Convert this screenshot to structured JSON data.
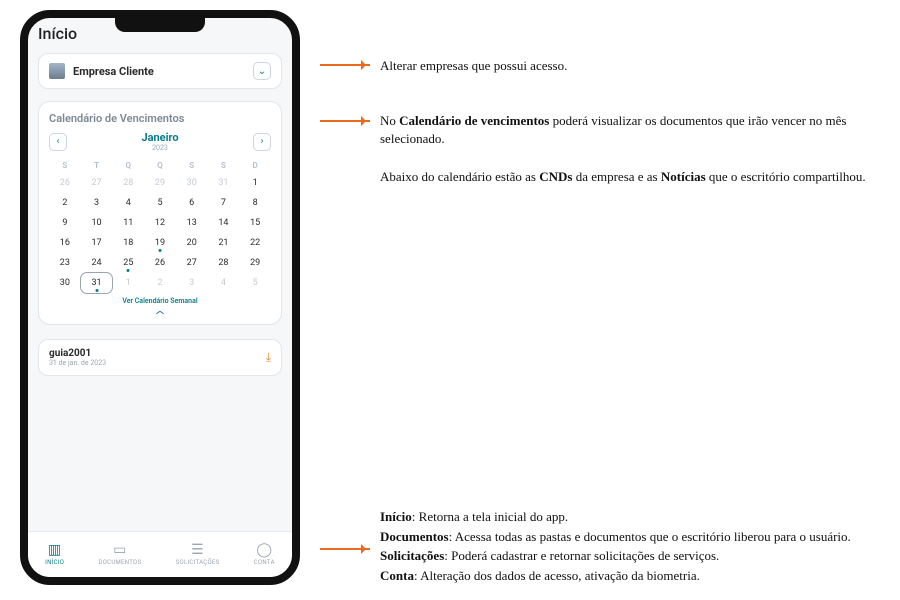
{
  "page_title": "Início",
  "company": {
    "name": "Empresa Cliente"
  },
  "calendar": {
    "title": "Calendário de Vencimentos",
    "month": "Janeiro",
    "year": "2023",
    "dow": [
      "S",
      "T",
      "Q",
      "Q",
      "S",
      "S",
      "D"
    ],
    "weeks": [
      [
        {
          "n": "26",
          "muted": true
        },
        {
          "n": "27",
          "muted": true
        },
        {
          "n": "28",
          "muted": true
        },
        {
          "n": "29",
          "muted": true
        },
        {
          "n": "30",
          "muted": true
        },
        {
          "n": "31",
          "muted": true
        },
        {
          "n": "1"
        }
      ],
      [
        {
          "n": "2"
        },
        {
          "n": "3"
        },
        {
          "n": "4"
        },
        {
          "n": "5"
        },
        {
          "n": "6"
        },
        {
          "n": "7"
        },
        {
          "n": "8"
        }
      ],
      [
        {
          "n": "9"
        },
        {
          "n": "10"
        },
        {
          "n": "11"
        },
        {
          "n": "12"
        },
        {
          "n": "13"
        },
        {
          "n": "14"
        },
        {
          "n": "15"
        }
      ],
      [
        {
          "n": "16"
        },
        {
          "n": "17"
        },
        {
          "n": "18"
        },
        {
          "n": "19",
          "dot": true
        },
        {
          "n": "20"
        },
        {
          "n": "21"
        },
        {
          "n": "22"
        }
      ],
      [
        {
          "n": "23"
        },
        {
          "n": "24"
        },
        {
          "n": "25",
          "dot": true
        },
        {
          "n": "26"
        },
        {
          "n": "27"
        },
        {
          "n": "28"
        },
        {
          "n": "29"
        }
      ],
      [
        {
          "n": "30"
        },
        {
          "n": "31",
          "dot": true,
          "selected": true
        },
        {
          "n": "1",
          "muted": true
        },
        {
          "n": "2",
          "muted": true
        },
        {
          "n": "3",
          "muted": true
        },
        {
          "n": "4",
          "muted": true
        },
        {
          "n": "5",
          "muted": true
        }
      ]
    ],
    "weekly_link": "Ver Calendário Semanal"
  },
  "doc": {
    "name": "guia2001",
    "date": "31 de jan. de 2023"
  },
  "nav": {
    "inicio": "INÍCIO",
    "documentos": "DOCUMENTOS",
    "solicitacoes": "SOLICITAÇÕES",
    "conta": "CONTA"
  },
  "annotations": {
    "a1": "Alterar empresas que possui acesso.",
    "a2_pre": "No ",
    "a2_b": "Calendário de vencimentos",
    "a2_post": " poderá visualizar os documentos que irão vencer no mês selecionado.",
    "a3_pre": "Abaixo do calendário estão as ",
    "a3_b1": "CNDs",
    "a3_mid": " da empresa e as ",
    "a3_b2": "Notícias",
    "a3_post": " que o escritório compartilhou.",
    "nav_inicio_b": "Início",
    "nav_inicio_t": ": Retorna a tela inicial do app.",
    "nav_doc_b": "Documentos",
    "nav_doc_t": ": Acessa todas as pastas e documentos que o escritório liberou para o usuário.",
    "nav_sol_b": "Solicitações",
    "nav_sol_t": ": Poderá cadastrar e retornar solicitações de serviços.",
    "nav_conta_b": "Conta",
    "nav_conta_t": ": Alteração dos dados de acesso, ativação da biometria."
  }
}
